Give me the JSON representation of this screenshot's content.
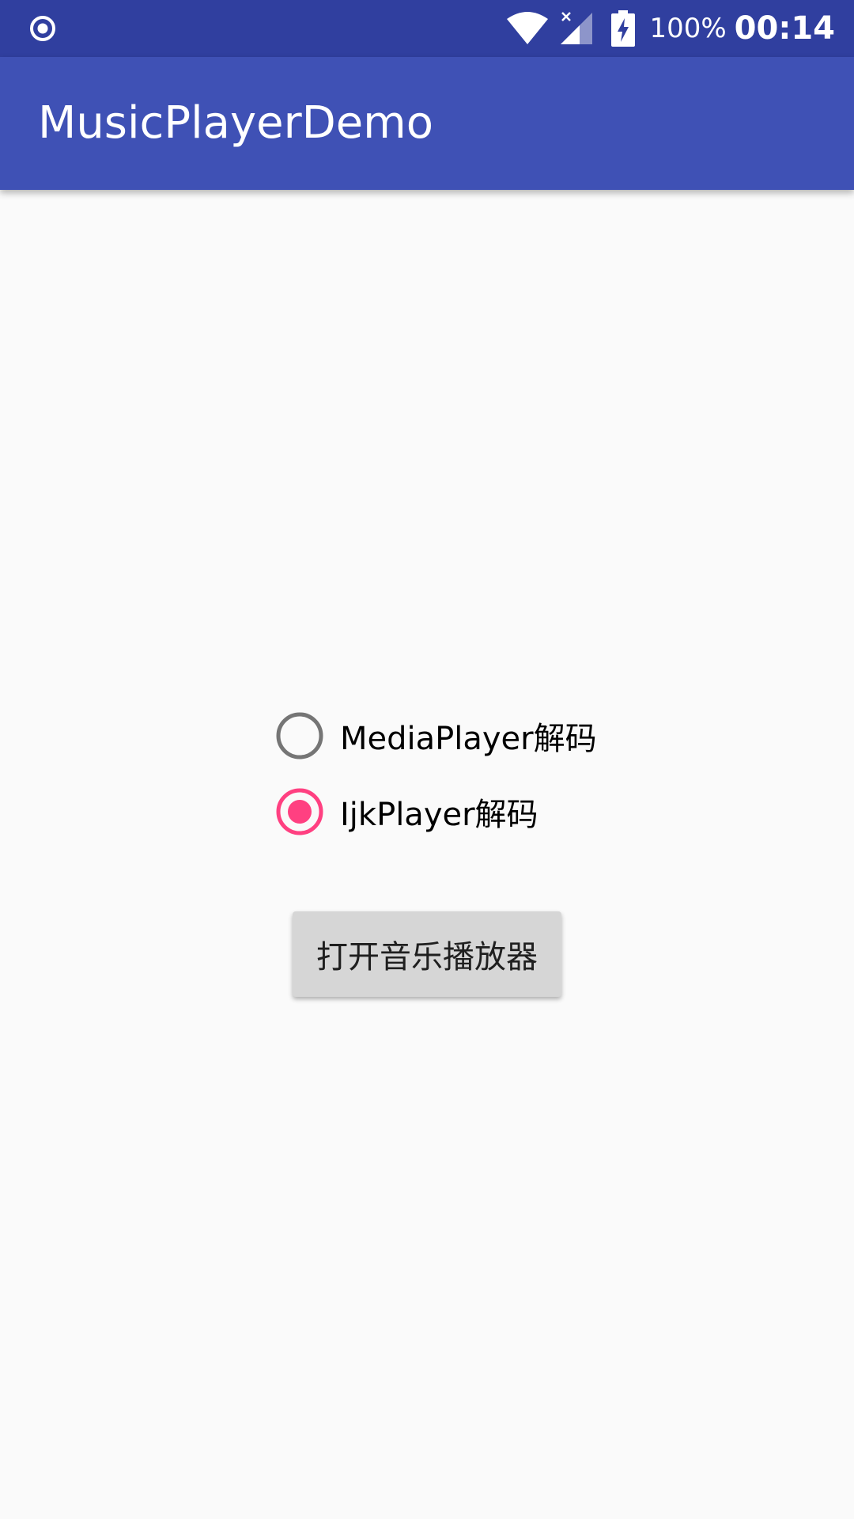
{
  "status_bar": {
    "battery_percent": "100%",
    "time": "00:14",
    "icons": [
      "radio-indicator-icon",
      "wifi-icon",
      "cell-signal-no-data-icon",
      "battery-charging-icon"
    ]
  },
  "app_bar": {
    "title": "MusicPlayerDemo"
  },
  "decoder_options": [
    {
      "label": "MediaPlayer解码",
      "checked": false
    },
    {
      "label": "IjkPlayer解码",
      "checked": true
    }
  ],
  "open_button": {
    "label": "打开音乐播放器"
  },
  "colors": {
    "status_bar": "#303f9f",
    "app_bar": "#3f51b5",
    "background": "#fafafa",
    "radio_checked": "#ff4081",
    "radio_unchecked": "#757575",
    "button": "#d6d6d6"
  }
}
